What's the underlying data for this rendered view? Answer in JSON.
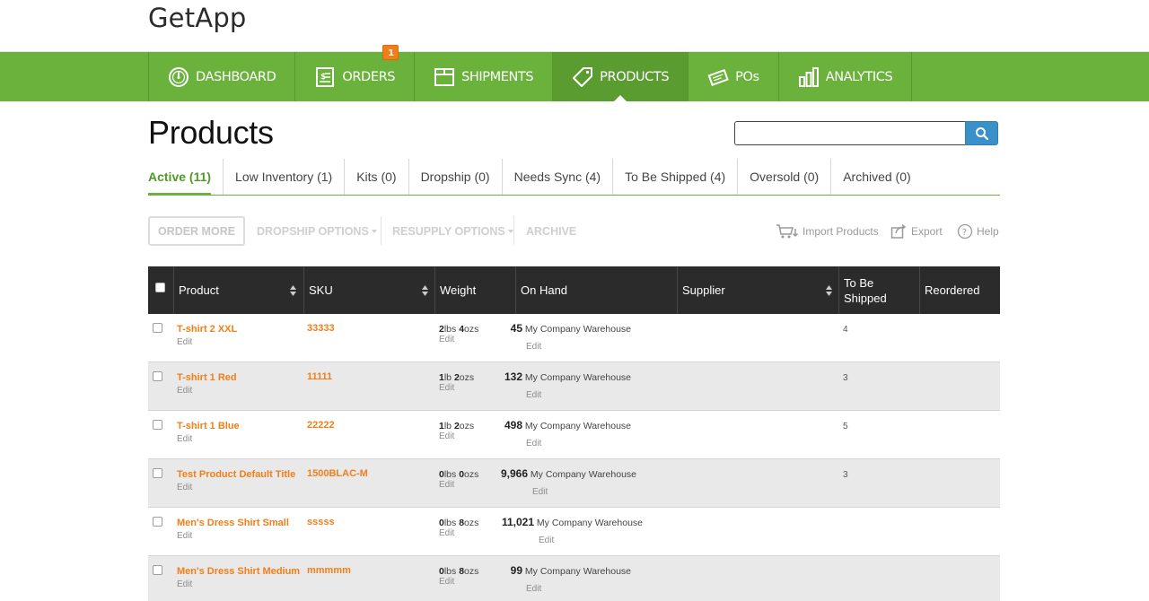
{
  "app": {
    "logo": "GetApp"
  },
  "nav": {
    "orders_badge": "1",
    "items": [
      {
        "label": "DASHBOARD",
        "icon": "dashboard-gauge-icon",
        "active": false
      },
      {
        "label": "ORDERS",
        "icon": "orders-document-icon",
        "active": false
      },
      {
        "label": "SHIPMENTS",
        "icon": "shipments-box-icon",
        "active": false
      },
      {
        "label": "PRODUCTS",
        "icon": "products-tag-icon",
        "active": true
      },
      {
        "label": "POs",
        "icon": "pos-tickets-icon",
        "active": false
      },
      {
        "label": "ANALYTICS",
        "icon": "analytics-bars-icon",
        "active": false
      }
    ]
  },
  "page": {
    "title": "Products"
  },
  "search": {
    "value": "",
    "icon": "search-icon"
  },
  "tabs": [
    {
      "label": "Active (11)",
      "active": true
    },
    {
      "label": "Low Inventory (1)",
      "active": false
    },
    {
      "label": "Kits (0)",
      "active": false
    },
    {
      "label": "Dropship (0)",
      "active": false
    },
    {
      "label": "Needs Sync (4)",
      "active": false
    },
    {
      "label": "To Be Shipped (4)",
      "active": false
    },
    {
      "label": "Oversold (0)",
      "active": false
    },
    {
      "label": "Archived (0)",
      "active": false
    }
  ],
  "toolbar": {
    "order_more": "ORDER MORE",
    "dropship_options": "DROPSHIP OPTIONS",
    "resupply_options": "RESUPPLY OPTIONS",
    "archive": "ARCHIVE",
    "import_products": "Import Products",
    "export": "Export",
    "help": "Help"
  },
  "table": {
    "columns": {
      "product": "Product",
      "sku": "SKU",
      "weight": "Weight",
      "on_hand": "On Hand",
      "supplier": "Supplier",
      "to_be_shipped_line1": "To Be",
      "to_be_shipped_line2": "Shipped",
      "reordered": "Reordered"
    },
    "edit_label": "Edit",
    "rows": [
      {
        "product": "T-shirt 2 XXL",
        "sku": "33333",
        "w1": "2",
        "w1u": "lbs ",
        "w2": "4",
        "w2u": "ozs",
        "qty": "45",
        "location": "My Company Warehouse",
        "supplier": "",
        "to_be_shipped": "4",
        "reordered": ""
      },
      {
        "product": "T-shirt 1 Red",
        "sku": "11111",
        "w1": "1",
        "w1u": "lb ",
        "w2": "2",
        "w2u": "ozs",
        "qty": "132",
        "location": "My Company Warehouse",
        "supplier": "",
        "to_be_shipped": "3",
        "reordered": ""
      },
      {
        "product": "T-shirt 1 Blue",
        "sku": "22222",
        "w1": "1",
        "w1u": "lb ",
        "w2": "2",
        "w2u": "ozs",
        "qty": "498",
        "location": "My Company Warehouse",
        "supplier": "",
        "to_be_shipped": "5",
        "reordered": ""
      },
      {
        "product": "Test Product Default Title",
        "sku": "1500BLAC-M",
        "w1": "0",
        "w1u": "lbs ",
        "w2": "0",
        "w2u": "ozs",
        "qty": "9,966",
        "location": "My Company Warehouse",
        "supplier": "",
        "to_be_shipped": "3",
        "reordered": ""
      },
      {
        "product": "Men's Dress Shirt Small",
        "sku": "sssss",
        "w1": "0",
        "w1u": "lbs ",
        "w2": "8",
        "w2u": "ozs",
        "qty": "11,021",
        "location": "My Company Warehouse",
        "supplier": "",
        "to_be_shipped": "",
        "reordered": ""
      },
      {
        "product": "Men's Dress Shirt Medium",
        "sku": "mmmmm",
        "w1": "0",
        "w1u": "lbs ",
        "w2": "8",
        "w2u": "ozs",
        "qty": "99",
        "location": "My Company Warehouse",
        "supplier": "",
        "to_be_shipped": "",
        "reordered": ""
      }
    ]
  },
  "colors": {
    "brand_green": "#6ab23b",
    "accent_orange": "#f07f1a",
    "search_blue": "#3a90c9",
    "header_dark": "#2b2b2b"
  }
}
